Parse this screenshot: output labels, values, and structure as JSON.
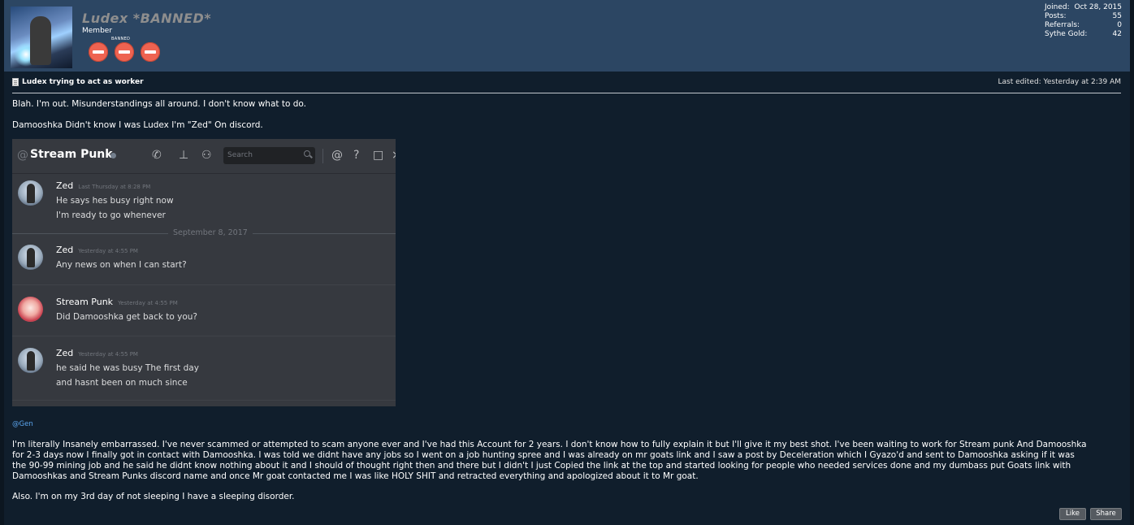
{
  "user": {
    "name": "Ludex *BANNED*",
    "title": "Member",
    "banned_label": "BANNED",
    "stats": [
      {
        "label": "Joined:",
        "value": "Oct 28, 2015"
      },
      {
        "label": "Posts:",
        "value": "55"
      },
      {
        "label": "Referrals:",
        "value": "0"
      },
      {
        "label": "Sythe Gold:",
        "value": "42"
      }
    ]
  },
  "post": {
    "title": "Ludex trying to act as worker",
    "last_edited": "Last edited: Yesterday at 2:39 AM",
    "line1": "Blah. I'm out. Misunderstandings all around. I don't know what to do.",
    "line2": "Damooshka Didn't know I was Ludex I'm \"Zed\" On discord.",
    "mention": "@Gen",
    "body": [
      "I'm literally Insanely embarrassed. I've never scammed or attempted to scam anyone ever and I've had this Account for 2 years. I don't know how to fully explain it but I'll give it my best shot. I've been waiting to work for Stream punk And Damooshka",
      "for 2-3 days now I finally got in contact with Damooshka. I was told we didnt have any jobs so I went on a job hunting spree and I was already on mr goats link and I saw a post by Deceleration which I Gyazo'd and sent to Damooshka asking if it was",
      "the 90-99 mining job and he said he didnt know nothing about it and I should of thought right then and there but I didn't I just Copied the link at the top and started looking for people who needed services done and my dumbass put Goats link with",
      "Damooshkas and Stream Punks discord name and once Mr goat contacted me I was like HOLY SHIT and retracted everything and apologized about it to Mr goat."
    ],
    "closing": "Also. I'm on my 3rd day of not sleeping I have a sleeping disorder.",
    "buttons": {
      "like": "Like",
      "share": "Share"
    }
  },
  "discord": {
    "at": "@",
    "channel": "Stream Punk",
    "search_placeholder": "Search",
    "date_divider": "September 8, 2017",
    "messages": [
      {
        "author": "Zed",
        "time": "Last Thursday at 8:28 PM",
        "lines": [
          "He says hes busy right now",
          "I'm ready to go whenever"
        ]
      },
      {
        "author": "Zed",
        "time": "Yesterday at 4:55 PM",
        "lines": [
          "Any news on when I can start?"
        ]
      },
      {
        "author": "Stream Punk",
        "time": "Yesterday at 4:55 PM",
        "lines": [
          "Did Damooshka get back to you?"
        ]
      },
      {
        "author": "Zed",
        "time": "Yesterday at 4:55 PM",
        "lines": [
          "he said he was busy The first day",
          "and hasnt been on much since"
        ]
      }
    ]
  },
  "colors": {
    "header_bg": "#2c4663",
    "post_bg": "#101e2c",
    "badge_red": "#ee6351",
    "discord_bg": "#36393f",
    "mention_blue": "#5ba5ee"
  }
}
